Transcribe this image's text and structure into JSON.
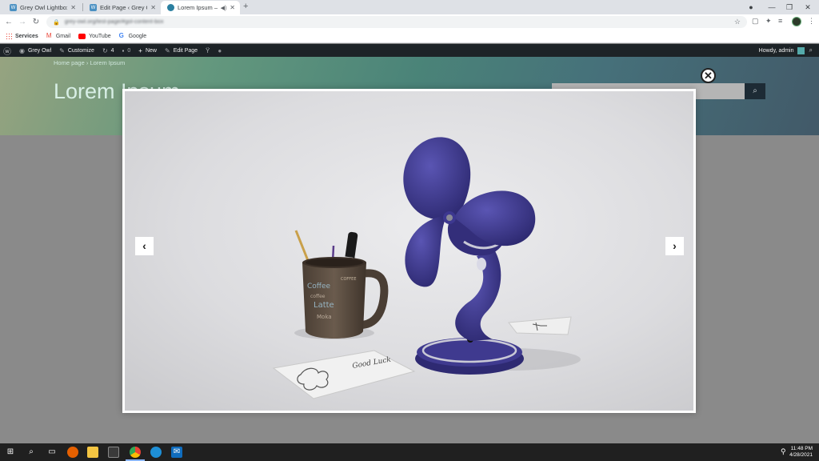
{
  "browser": {
    "tabs": [
      {
        "label": "Grey Owl Lightbox ‹ Gr",
        "active": false
      },
      {
        "label": "Edit Page ‹ Grey Owl —",
        "active": false
      },
      {
        "label": "Lorem Ipsum – Gr",
        "active": true
      }
    ],
    "new_tab": "+",
    "window_controls": {
      "minimize": "—",
      "restore": "❒",
      "close": "✕"
    },
    "url": "grey-owl.org/test-page/#gol-content-box",
    "bookmarks": [
      {
        "label": "Services",
        "icon": "apps-icon"
      },
      {
        "label": "Gmail",
        "icon": "gmail-icon"
      },
      {
        "label": "YouTube",
        "icon": "youtube-icon"
      },
      {
        "label": "Google",
        "icon": "google-icon"
      }
    ]
  },
  "adminbar": {
    "site_name": "Grey Owl",
    "customize": "Customize",
    "updates_count": "4",
    "comments_count": "0",
    "new_label": "New",
    "edit_page": "Edit Page",
    "greeting": "Howdy, admin"
  },
  "page": {
    "breadcrumb": "Home page › Lorem Ipsum",
    "title": "Lorem Ipsum"
  },
  "lightbox": {
    "close_symbol": "✕",
    "prev_symbol": "‹",
    "next_symbol": "›",
    "image_text": {
      "mug_lines": [
        "Coffee",
        "coffee",
        "Latte",
        "COFFEE",
        "Moka"
      ],
      "card_text": "Good Luck"
    },
    "colors": {
      "fan": "#3f3a8f",
      "mug": "#5a4c40"
    }
  },
  "taskbar": {
    "time": "11:48 PM",
    "date": "4/28/2021"
  }
}
